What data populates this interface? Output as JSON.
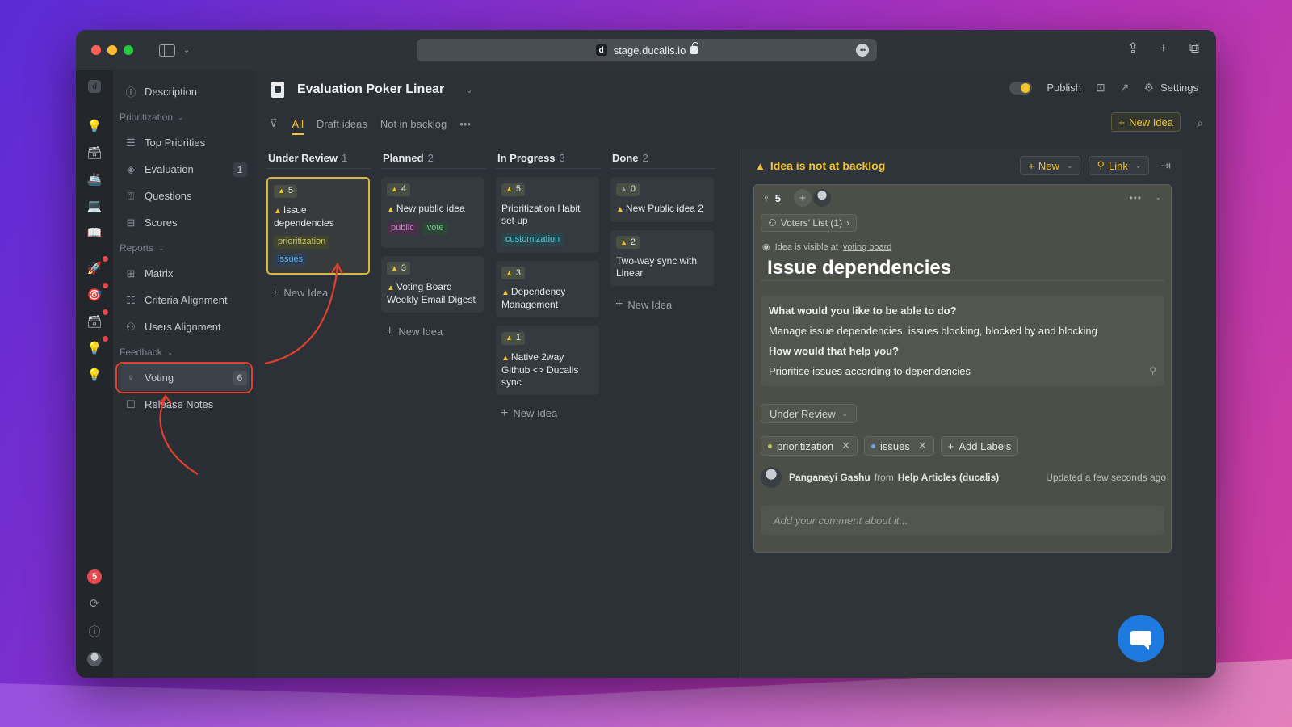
{
  "browser": {
    "url": "stage.ducalis.io",
    "favicon_letter": "d"
  },
  "rail": {
    "logo_letter": "d",
    "badge_count": "5"
  },
  "nav": {
    "description": "Description",
    "prioritization_section": "Prioritization",
    "top_priorities": "Top Priorities",
    "evaluation": "Evaluation",
    "evaluation_count": "1",
    "questions": "Questions",
    "scores": "Scores",
    "reports_section": "Reports",
    "matrix": "Matrix",
    "criteria_alignment": "Criteria Alignment",
    "users_alignment": "Users Alignment",
    "feedback_section": "Feedback",
    "voting": "Voting",
    "voting_count": "6",
    "release_notes": "Release Notes"
  },
  "header": {
    "project_title": "Evaluation Poker Linear",
    "publish_label": "Publish",
    "settings_label": "Settings",
    "publish_on": true
  },
  "filters": {
    "tabs": [
      "All",
      "Draft ideas",
      "Not in backlog"
    ],
    "active_tab": "All",
    "more": "•••",
    "new_idea_label": "New Idea"
  },
  "board": {
    "add_idea_label": "New Idea",
    "columns": [
      {
        "title": "Under Review",
        "count": "1",
        "cards": [
          {
            "votes": "5",
            "title": "Issue dependencies",
            "tags": [
              {
                "text": "prioritization",
                "kind": "prio"
              },
              {
                "text": "issues",
                "kind": "issues"
              }
            ],
            "selected": true
          }
        ]
      },
      {
        "title": "Planned",
        "count": "2",
        "cards": [
          {
            "votes": "4",
            "title": "New public idea",
            "tags": [
              {
                "text": "public",
                "kind": "public"
              },
              {
                "text": "vote",
                "kind": "vote"
              }
            ]
          },
          {
            "votes": "3",
            "title": "Voting Board Weekly Email Digest",
            "tags": []
          }
        ]
      },
      {
        "title": "In Progress",
        "count": "3",
        "cards": [
          {
            "votes": "5",
            "title": "Prioritization Habit set up",
            "tags": [
              {
                "text": "customization",
                "kind": "custom"
              }
            ],
            "noWarn": true
          },
          {
            "votes": "3",
            "title": "Dependency Management",
            "tags": []
          },
          {
            "votes": "1",
            "title": "Native 2way Github <> Ducalis sync",
            "tags": []
          }
        ]
      },
      {
        "title": "Done",
        "count": "2",
        "cards": [
          {
            "votes": "0",
            "title": "New Public idea 2",
            "tags": [],
            "zero": true
          },
          {
            "votes": "2",
            "title": "Two-way sync with Linear",
            "tags": [],
            "noWarn": true
          }
        ]
      }
    ]
  },
  "detail": {
    "warning_title": "Idea is not at backlog",
    "new_btn": "New",
    "link_btn": "Link",
    "vote_count": "5",
    "voters_list": "Voters' List (1)",
    "visible_prefix": "Idea is visible at",
    "visible_link": "voting board",
    "title": "Issue dependencies",
    "q1": "What would you like to be able to do?",
    "a1": "Manage issue dependencies, issues blocking, blocked by and blocking",
    "q2": "How would that help you?",
    "a2": "Prioritise issues according to dependencies",
    "status": "Under Review",
    "labels": [
      {
        "text": "prioritization",
        "color": "#c8c55a"
      },
      {
        "text": "issues",
        "color": "#63a8e6"
      }
    ],
    "add_labels": "Add Labels",
    "author_name": "Panganayi Gashu",
    "author_from": "from",
    "author_source": "Help Articles (ducalis)",
    "updated": "Updated a few seconds ago",
    "comment_placeholder": "Add your comment about it..."
  },
  "colors": {
    "accent_yellow": "#f2c230",
    "annotation_red": "#e0402d",
    "chat_blue": "#1f7ae0"
  }
}
